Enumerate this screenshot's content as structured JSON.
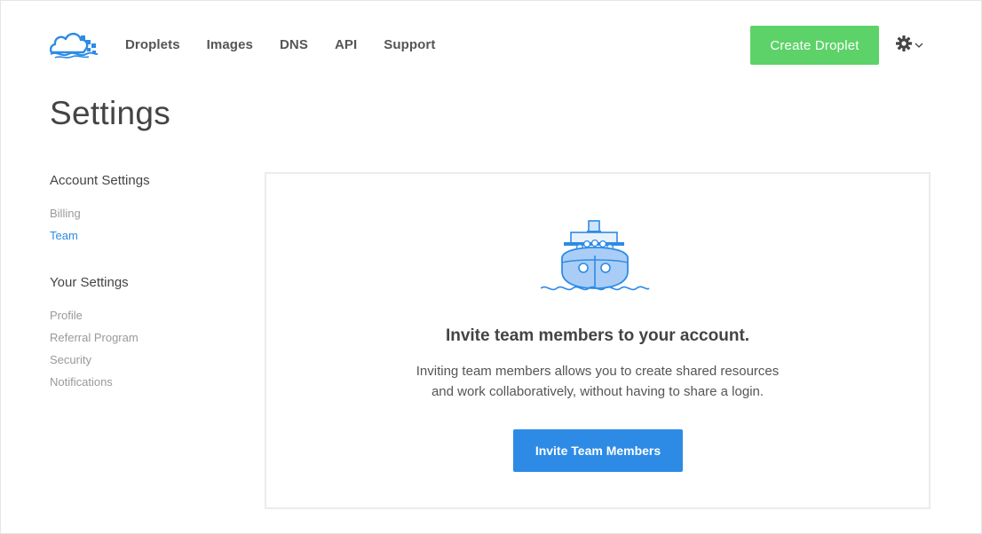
{
  "nav": {
    "items": [
      "Droplets",
      "Images",
      "DNS",
      "API",
      "Support"
    ]
  },
  "header": {
    "create_label": "Create Droplet",
    "settings_icon": "gear-icon",
    "dropdown_icon": "chevron-down-icon"
  },
  "page": {
    "title": "Settings"
  },
  "sidebar": {
    "sections": [
      {
        "heading": "Account Settings",
        "items": [
          {
            "label": "Billing",
            "active": false
          },
          {
            "label": "Team",
            "active": true
          }
        ]
      },
      {
        "heading": "Your Settings",
        "items": [
          {
            "label": "Profile",
            "active": false
          },
          {
            "label": "Referral Program",
            "active": false
          },
          {
            "label": "Security",
            "active": false
          },
          {
            "label": "Notifications",
            "active": false
          }
        ]
      }
    ]
  },
  "panel": {
    "illustration": "team-ship-illustration",
    "heading": "Invite team members to your account.",
    "text_line1": "Inviting team members allows you to create shared resources",
    "text_line2": "and work collaboratively, without having to share a login.",
    "button_label": "Invite Team Members"
  },
  "colors": {
    "brand_blue": "#2d8be6",
    "create_green": "#5cd268",
    "muted_text": "#999999"
  }
}
